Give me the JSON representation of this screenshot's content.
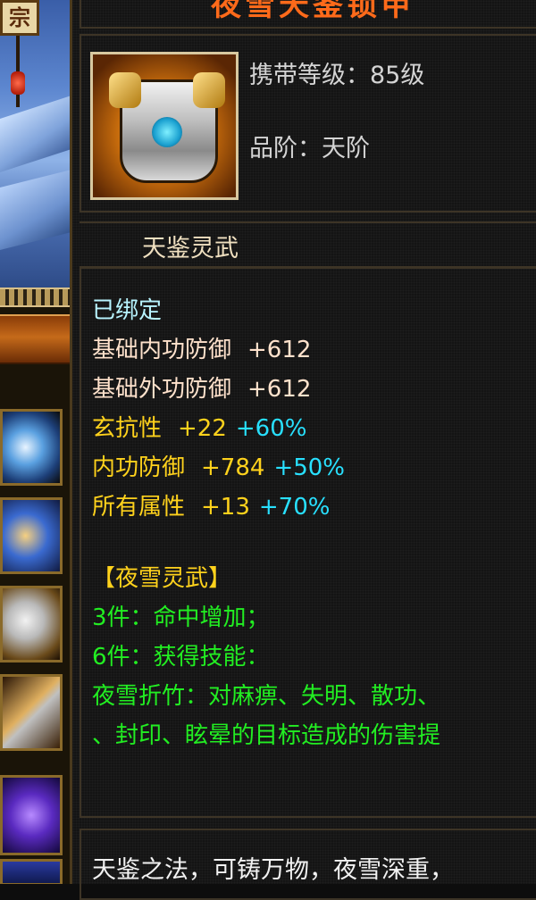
{
  "scene": {
    "sign_char": "宗"
  },
  "tooltip": {
    "item_name": "夜雪天鉴锁甲",
    "carry_level": "携带等级：85级",
    "grade": "品阶：天阶",
    "set_group": "天鉴灵武",
    "bound": "已绑定",
    "stats": [
      {
        "name": "基础内功防御",
        "value": "+612",
        "percent": ""
      },
      {
        "name": "基础外功防御",
        "value": "+612",
        "percent": ""
      },
      {
        "name": "玄抗性",
        "value": "+22",
        "percent": "+60%"
      },
      {
        "name": "内功防御",
        "value": "+784",
        "percent": "+50%"
      },
      {
        "name": "所有属性",
        "value": "+13",
        "percent": "+70%"
      }
    ],
    "set_title": "【夜雪灵武】",
    "set_bonus_3": "3件：命中增加；",
    "set_bonus_6": "6件：获得技能：",
    "skill_line1": "夜雪折竹：对麻痹、失明、散功、",
    "skill_line2": "、封印、眩晕的目标造成的伤害提",
    "description": "天鉴之法，可铸万物，夜雪深重，"
  },
  "colors": {
    "item_name": "#ff6a1a",
    "bound": "#b8f4ff",
    "base_stat": "#ffe2cc",
    "extra_stat": "#ffd21c",
    "percent": "#28e0ff",
    "set_text": "#22ee22"
  },
  "inventory": {
    "slots": [
      "ring-icon",
      "cross-weapon-icon",
      "armor-icon",
      "sword-icon",
      "spirit-beast-icon",
      "item-icon"
    ]
  }
}
